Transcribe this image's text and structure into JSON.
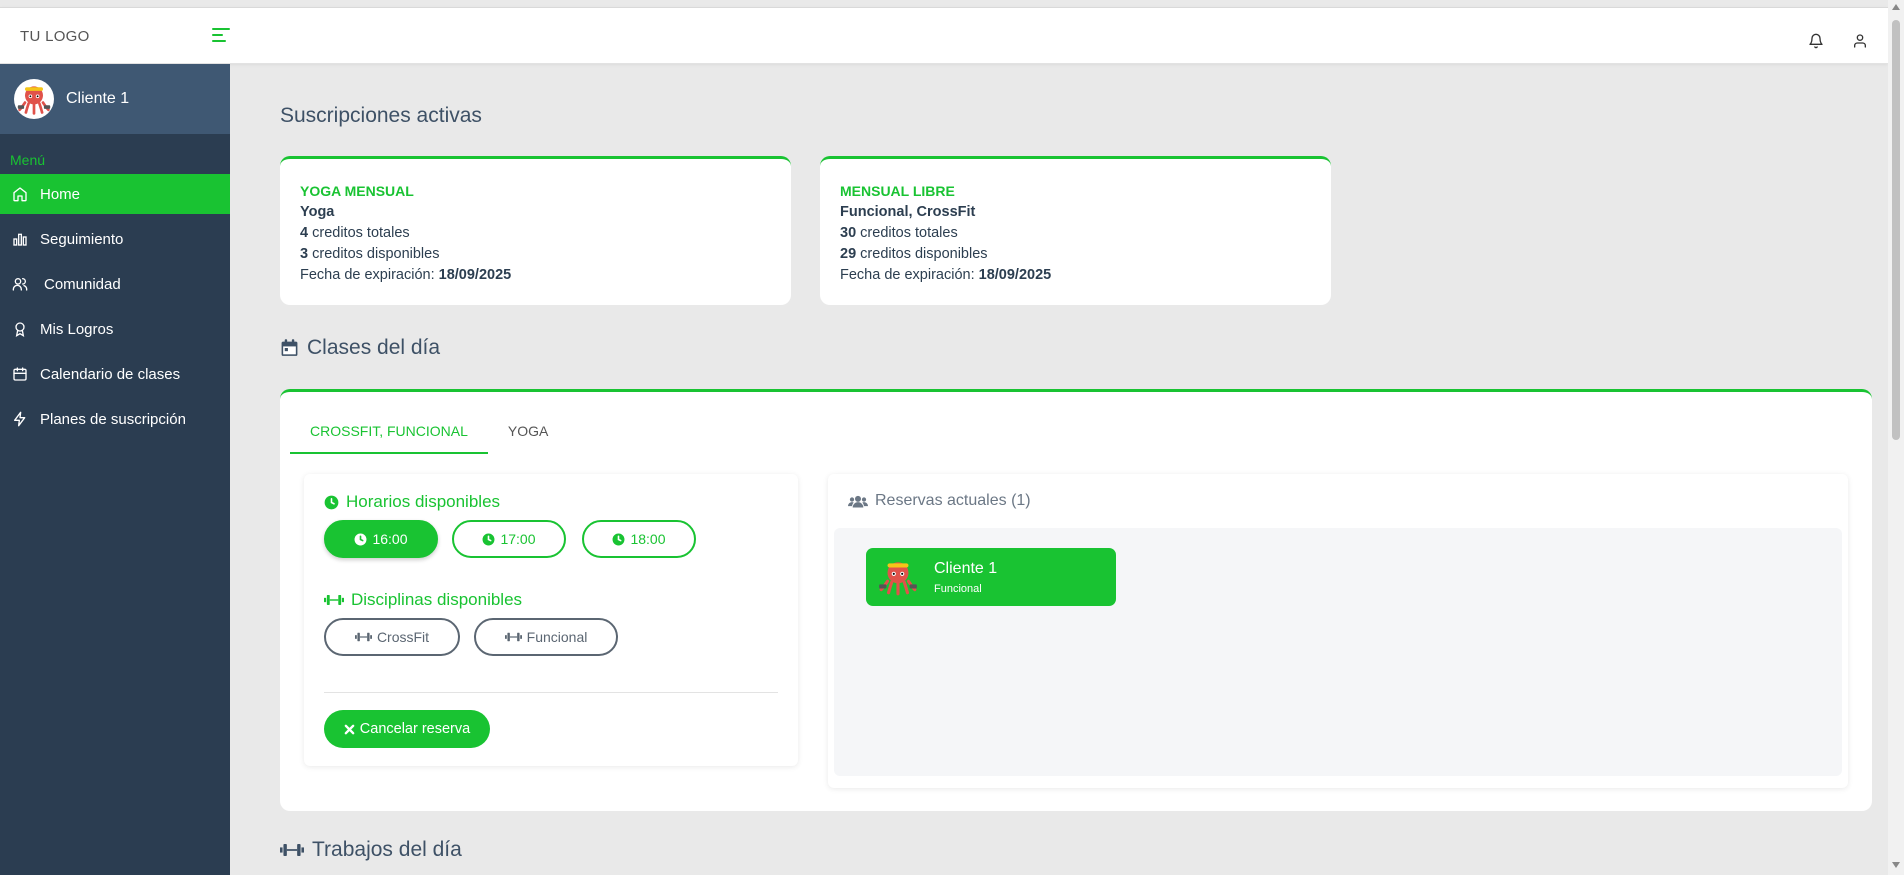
{
  "header": {
    "logo": "TU LOGO",
    "icons": {
      "menu": "menu-toggle-icon",
      "notifications": "bell-icon",
      "user": "user-icon"
    }
  },
  "sidebar": {
    "profile_name": "Cliente 1",
    "menu_title": "Menú",
    "items": [
      {
        "label": "Home",
        "icon": "home-icon",
        "active": true
      },
      {
        "label": "Seguimiento",
        "icon": "bar-chart-icon"
      },
      {
        "label": "Comunidad",
        "icon": "users-icon"
      },
      {
        "label": "Mis Logros",
        "icon": "award-icon"
      },
      {
        "label": "Calendario de clases",
        "icon": "calendar-icon"
      },
      {
        "label": "Planes de suscripción",
        "icon": "lightning-icon"
      }
    ]
  },
  "subscriptions": {
    "title": "Suscripciones activas",
    "cards": [
      {
        "plan": "YOGA MENSUAL",
        "disciplines": "Yoga",
        "total_credits": "4",
        "total_label": "creditos totales",
        "available_credits": "3",
        "available_label": "creditos disponibles",
        "expiry_label": "Fecha de expiración:",
        "expiry_date": "18/09/2025"
      },
      {
        "plan": "MENSUAL LIBRE",
        "disciplines": "Funcional, CrossFit",
        "total_credits": "30",
        "total_label": "creditos totales",
        "available_credits": "29",
        "available_label": "creditos disponibles",
        "expiry_label": "Fecha de expiración:",
        "expiry_date": "18/09/2025"
      }
    ]
  },
  "classes": {
    "title": "Clases del día",
    "tabs": [
      "CROSSFIT, FUNCIONAL",
      "YOGA"
    ],
    "active_tab": 0,
    "schedules_title": "Horarios disponibles",
    "schedules": [
      "16:00",
      "17:00",
      "18:00"
    ],
    "selected_schedule": "16:00",
    "disciplines_title": "Disciplinas disponibles",
    "disciplines": [
      "CrossFit",
      "Funcional"
    ],
    "cancel_label": "Cancelar reserva",
    "reservations_title": "Reservas actuales (1)",
    "reservations": [
      {
        "name": "Cliente 1",
        "discipline": "Funcional"
      }
    ]
  },
  "workouts": {
    "title": "Trabajos del día"
  },
  "colors": {
    "accent": "#19c332",
    "sidebar": "#2b3d51",
    "sidebar_profile": "#3f5873",
    "background": "#e9e9e9"
  }
}
